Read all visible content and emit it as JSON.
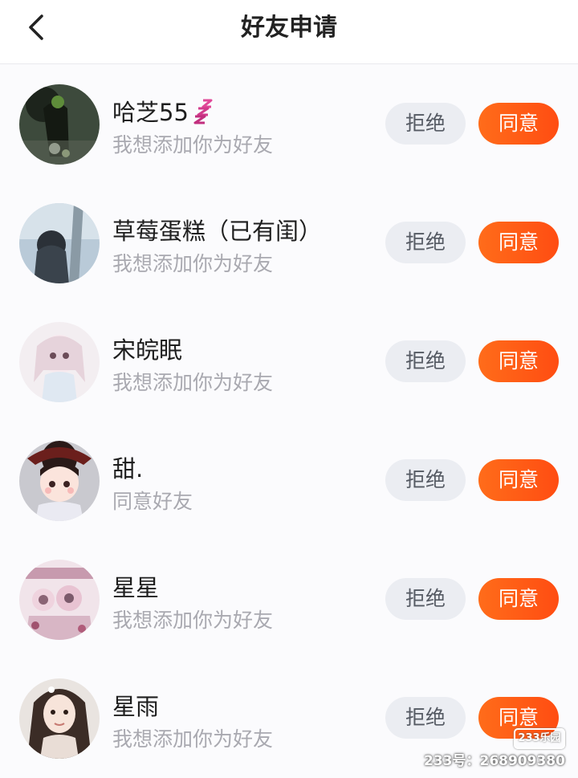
{
  "header": {
    "title": "好友申请",
    "back_icon": "chevron-left-icon"
  },
  "colors": {
    "accept_gradient_start": "#ff6c1a",
    "accept_gradient_end": "#ff4d12",
    "reject_bg": "#ebedf2",
    "message_text": "#a9a9b0"
  },
  "requests": [
    {
      "name": "哈芝55",
      "message": "我想添加你为好友",
      "has_sleep_icon": true,
      "reject_label": "拒绝",
      "accept_label": "同意"
    },
    {
      "name": "草莓蛋糕（已有闺）",
      "message": "我想添加你为好友",
      "reject_label": "拒绝",
      "accept_label": "同意"
    },
    {
      "name": "宋皖眠",
      "message": "我想添加你为好友",
      "reject_label": "拒绝",
      "accept_label": "同意"
    },
    {
      "name": "甜.",
      "message": "同意好友",
      "reject_label": "拒绝",
      "accept_label": "同意"
    },
    {
      "name": "星星",
      "message": "我想添加你为好友",
      "reject_label": "拒绝",
      "accept_label": "同意"
    },
    {
      "name": "星雨",
      "message": "我想添加你为好友",
      "reject_label": "拒绝",
      "accept_label": "同意"
    }
  ],
  "watermark": {
    "logo_text": "233乐园",
    "id_text": "233号：268909380"
  }
}
